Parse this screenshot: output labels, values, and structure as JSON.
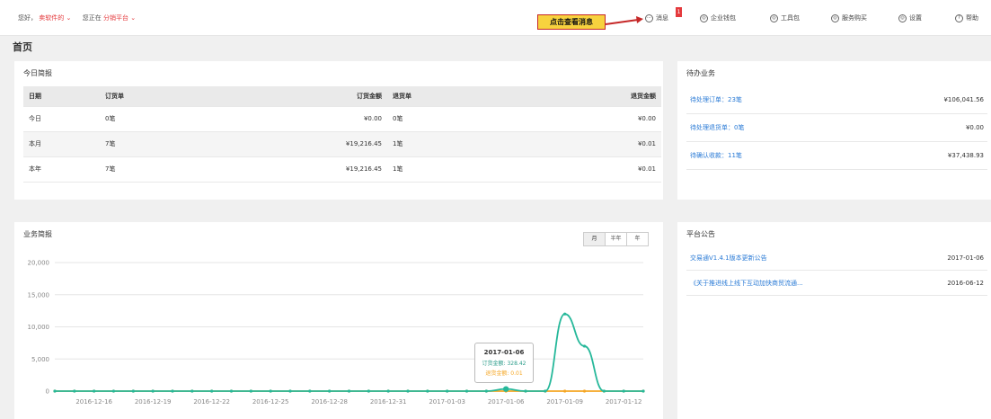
{
  "topbar": {
    "greeting": "您好，",
    "user": "卖软件的 ⌄",
    "location_label": "您正在",
    "platform": "分销平台 ⌄",
    "callout": "点击查看消息",
    "badge": "1",
    "nav": [
      {
        "label": "消息",
        "icon": "message-icon",
        "glyph": "⋯"
      },
      {
        "label": "企业钱包",
        "icon": "wallet-icon",
        "glyph": "◎"
      },
      {
        "label": "工具包",
        "icon": "toolkit-icon",
        "glyph": "◎"
      },
      {
        "label": "服务购买",
        "icon": "service-icon",
        "glyph": "◎"
      },
      {
        "label": "设置",
        "icon": "settings-icon",
        "glyph": "◎"
      },
      {
        "label": "帮助",
        "icon": "help-icon",
        "glyph": "?"
      }
    ]
  },
  "page_title": "首页",
  "today": {
    "title": "今日简报",
    "headers": [
      "日期",
      "订货单",
      "订货金额",
      "退货单",
      "退货金额"
    ],
    "rows": [
      [
        "今日",
        "0笔",
        "¥0.00",
        "0笔",
        "¥0.00"
      ],
      [
        "本月",
        "7笔",
        "¥19,216.45",
        "1笔",
        "¥0.01"
      ],
      [
        "本年",
        "7笔",
        "¥19,216.45",
        "1笔",
        "¥0.01"
      ]
    ]
  },
  "pending": {
    "title": "待办业务",
    "items": [
      {
        "label": "待处理订单：23笔",
        "value": "¥106,041.56"
      },
      {
        "label": "待处理退货单：0笔",
        "value": "¥0.00"
      },
      {
        "label": "待确认收款：11笔",
        "value": "¥37,438.93"
      }
    ]
  },
  "business": {
    "title": "业务简报",
    "ranges": [
      "月",
      "半年",
      "年"
    ],
    "active_range": "月"
  },
  "notices": {
    "title": "平台公告",
    "items": [
      {
        "label": "交易通V1.4.1版本更新公告",
        "date": "2017-01-06"
      },
      {
        "label": "《关于推进线上线下互动加快商贸流通...",
        "date": "2016-06-12"
      }
    ]
  },
  "tooltip": {
    "date": "2017-01-06",
    "order_line": "订货金额: 328.42",
    "return_line": "退货金额: 0.01"
  },
  "chart_data": {
    "type": "line",
    "ylim": [
      0,
      20000
    ],
    "yticks": [
      "0",
      "5,000",
      "10,000",
      "15,000",
      "20,000"
    ],
    "ytick_values": [
      0,
      5000,
      10000,
      15000,
      20000
    ],
    "xtick_labels": [
      "2016-12-16",
      "2016-12-19",
      "2016-12-22",
      "2016-12-25",
      "2016-12-28",
      "2016-12-31",
      "2017-01-03",
      "2017-01-06",
      "2017-01-09",
      "2017-01-12"
    ],
    "x": [
      "2016-12-14",
      "2016-12-15",
      "2016-12-16",
      "2016-12-17",
      "2016-12-18",
      "2016-12-19",
      "2016-12-20",
      "2016-12-21",
      "2016-12-22",
      "2016-12-23",
      "2016-12-24",
      "2016-12-25",
      "2016-12-26",
      "2016-12-27",
      "2016-12-28",
      "2016-12-29",
      "2016-12-30",
      "2016-12-31",
      "2017-01-01",
      "2017-01-02",
      "2017-01-03",
      "2017-01-04",
      "2017-01-05",
      "2017-01-06",
      "2017-01-07",
      "2017-01-08",
      "2017-01-09",
      "2017-01-10",
      "2017-01-11",
      "2017-01-12",
      "2017-01-13"
    ],
    "series": [
      {
        "name": "订货金额",
        "color": "#26b89a",
        "values": [
          0,
          0,
          0,
          0,
          0,
          0,
          0,
          0,
          0,
          0,
          0,
          0,
          0,
          0,
          0,
          0,
          0,
          0,
          0,
          0,
          0,
          0,
          0,
          328.42,
          0,
          0,
          12000,
          7000,
          0,
          0,
          0
        ]
      },
      {
        "name": "退货金额",
        "color": "#f5a623",
        "values": [
          0,
          0,
          0,
          0,
          0,
          0,
          0,
          0,
          0,
          0,
          0,
          0,
          0,
          0,
          0,
          0,
          0,
          0,
          0,
          0,
          0,
          0,
          0,
          0.01,
          0,
          0,
          0,
          0,
          0,
          0,
          0
        ]
      }
    ],
    "grid": true
  }
}
